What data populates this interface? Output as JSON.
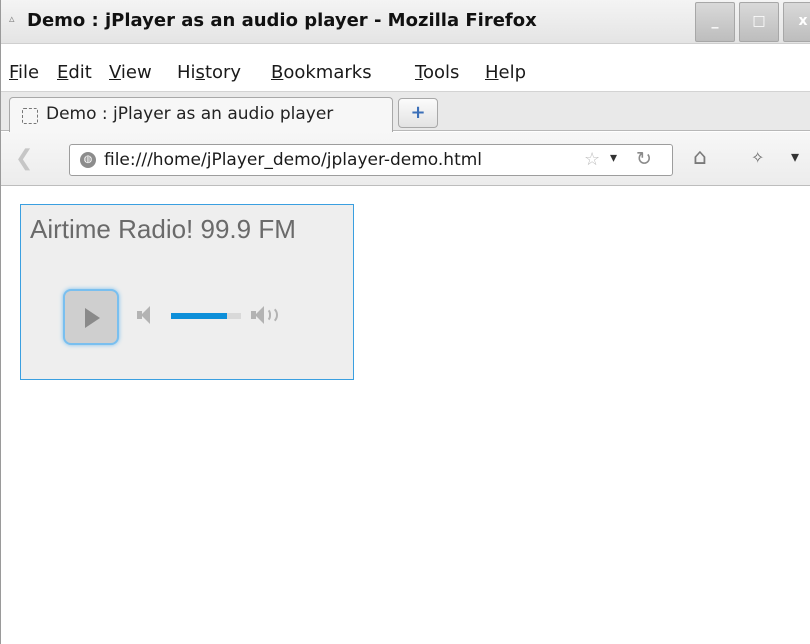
{
  "window": {
    "title": "Demo : jPlayer as an audio player - Mozilla Firefox",
    "controls": {
      "minimize": "_",
      "maximize": "□",
      "close": "x"
    }
  },
  "menubar": {
    "items": [
      {
        "label": "File",
        "mnemonic": "F",
        "rest": "ile"
      },
      {
        "label": "Edit",
        "mnemonic": "E",
        "rest": "dit"
      },
      {
        "label": "View",
        "mnemonic": "V",
        "rest": "iew"
      },
      {
        "label": "History",
        "pre": "Hi",
        "mnemonic": "s",
        "rest": "tory"
      },
      {
        "label": "Bookmarks",
        "mnemonic": "B",
        "rest": "ookmarks"
      },
      {
        "label": "Tools",
        "mnemonic": "T",
        "rest": "ools"
      },
      {
        "label": "Help",
        "mnemonic": "H",
        "rest": "elp"
      }
    ]
  },
  "tabs": [
    {
      "title": "Demo : jPlayer as an audio player",
      "active": true
    }
  ],
  "newtab": {
    "glyph": "+"
  },
  "navbar": {
    "url": "file:///home/jPlayer_demo/jplayer-demo.html",
    "icons": [
      "back-icon",
      "globe-icon",
      "star-icon",
      "dropdown-icon",
      "reload-icon",
      "home-icon",
      "addon-icon",
      "menu-chevron-icon"
    ]
  },
  "player": {
    "station": "Airtime Radio! 99.9 FM",
    "volume": 0.8,
    "accent": "#0d8fd9",
    "border_color": "#3a9fe0"
  }
}
